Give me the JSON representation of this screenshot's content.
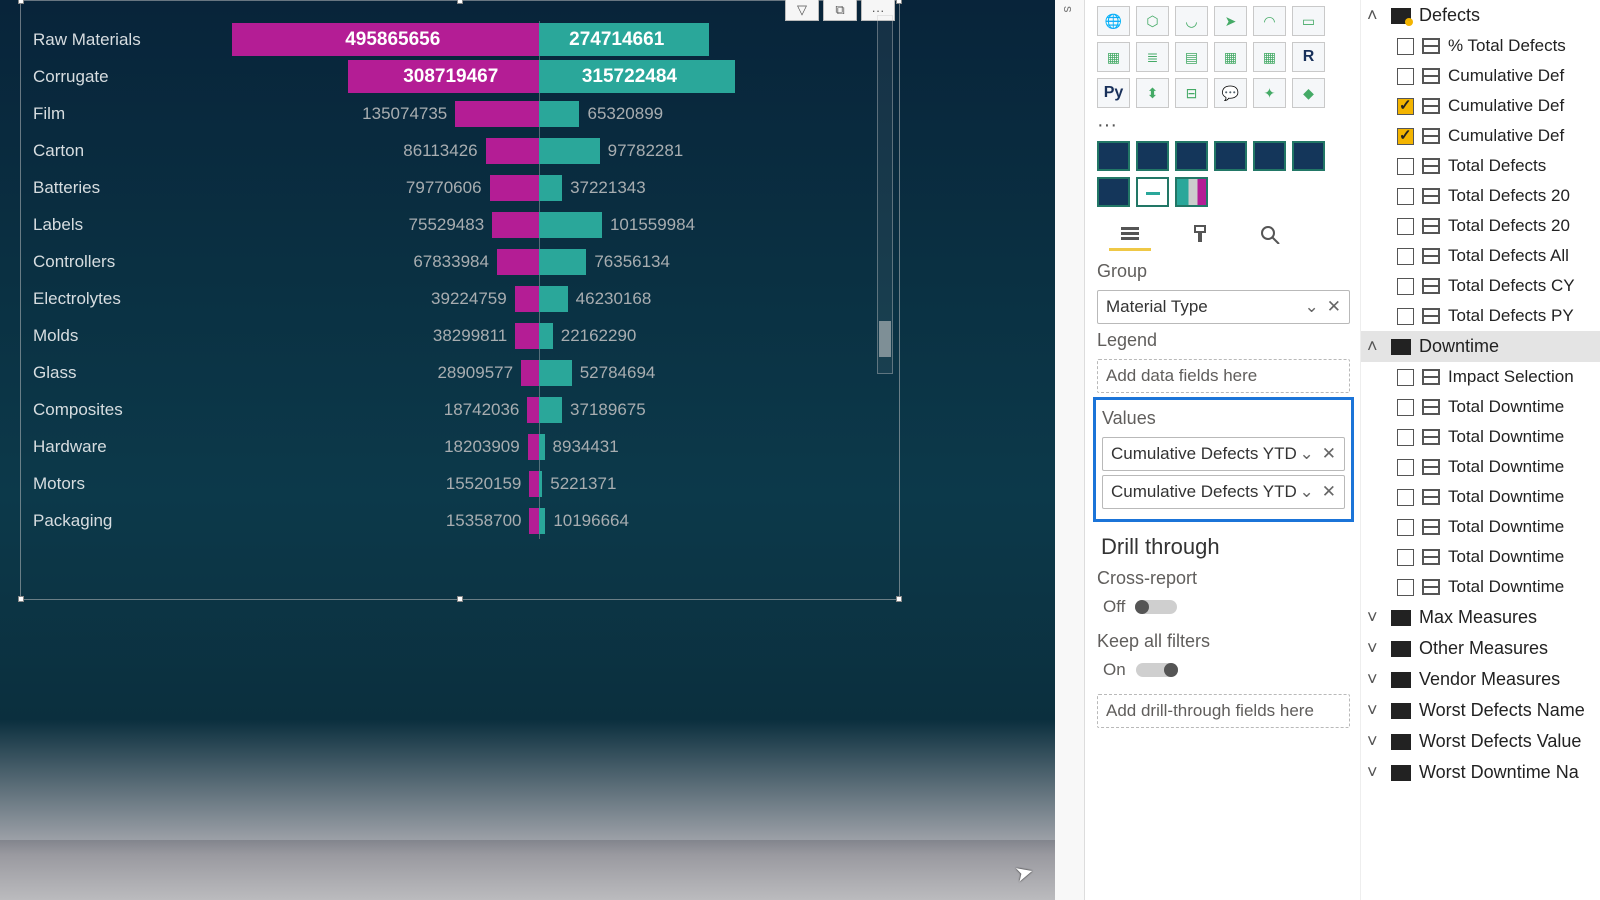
{
  "chart_data": {
    "type": "bar",
    "orientation": "diverging-horizontal",
    "categories": [
      "Raw Materials",
      "Corrugate",
      "Film",
      "Carton",
      "Batteries",
      "Labels",
      "Controllers",
      "Electrolytes",
      "Molds",
      "Glass",
      "Composites",
      "Hardware",
      "Motors",
      "Packaging"
    ],
    "series": [
      {
        "name": "Cumulative Defects YTD (left)",
        "color": "#b41d95",
        "values": [
          495865656,
          308719467,
          135074735,
          86113426,
          79770606,
          75529483,
          67833984,
          39224759,
          38299811,
          28909577,
          18742036,
          18203909,
          15520159,
          15358700
        ]
      },
      {
        "name": "Cumulative Defects YTD (right)",
        "color": "#2aa79a",
        "values": [
          274714661,
          315722484,
          65320899,
          97782281,
          37221343,
          101559984,
          76356134,
          46230168,
          22162290,
          52784694,
          37189675,
          8934431,
          5221371,
          10196664
        ]
      }
    ],
    "xlabel": "",
    "ylabel": "",
    "x_range": [
      -500000000,
      500000000
    ]
  },
  "vis_header": {
    "filter": "▽",
    "focus": "⧉",
    "more": "···"
  },
  "viz_pane": {
    "gallery_row1": [
      "globe",
      "shield",
      "arc",
      "arrow",
      "gauge",
      "card"
    ],
    "gallery_row2": [
      "table",
      "rows",
      "grid",
      "matrix",
      "matrix2",
      "R"
    ],
    "gallery_row3": [
      "Py",
      "kpi",
      "tree",
      "chat",
      "ai",
      "shape"
    ],
    "custom_row1": [
      "c1",
      "c2",
      "c3",
      "c4",
      "c5",
      "c6"
    ],
    "custom_row2": [
      "c7",
      "c8",
      "c9"
    ],
    "tabs": {
      "fields": "fields",
      "format": "format",
      "analytics": "analytics"
    },
    "group_label": "Group",
    "group_field": "Material Type",
    "legend_label": "Legend",
    "legend_placeholder": "Add data fields here",
    "values_label": "Values",
    "values_fields": [
      "Cumulative Defects YTD",
      "Cumulative Defects YTD"
    ],
    "drill_title": "Drill through",
    "cross_report_label": "Cross-report",
    "cross_report_state": "Off",
    "keep_filters_label": "Keep all filters",
    "keep_filters_state": "On",
    "drill_placeholder": "Add drill-through fields here"
  },
  "fields_pane": {
    "tables": [
      {
        "name": "Defects",
        "expanded": true,
        "alert": true,
        "fields": [
          {
            "label": "% Total Defects",
            "checked": false
          },
          {
            "label": "Cumulative Def",
            "checked": false
          },
          {
            "label": "Cumulative Def",
            "checked": true
          },
          {
            "label": "Cumulative Def",
            "checked": true
          },
          {
            "label": "Total Defects",
            "checked": false
          },
          {
            "label": "Total Defects 20",
            "checked": false
          },
          {
            "label": "Total Defects 20",
            "checked": false
          },
          {
            "label": "Total Defects All",
            "checked": false
          },
          {
            "label": "Total Defects CY",
            "checked": false
          },
          {
            "label": "Total Defects PY",
            "checked": false
          }
        ]
      },
      {
        "name": "Downtime",
        "expanded": true,
        "alert": false,
        "selected": true,
        "fields": [
          {
            "label": "Impact Selection",
            "checked": false
          },
          {
            "label": "Total Downtime",
            "checked": false
          },
          {
            "label": "Total Downtime",
            "checked": false
          },
          {
            "label": "Total Downtime",
            "checked": false
          },
          {
            "label": "Total Downtime",
            "checked": false
          },
          {
            "label": "Total Downtime",
            "checked": false
          },
          {
            "label": "Total Downtime",
            "checked": false
          },
          {
            "label": "Total Downtime",
            "checked": false
          }
        ]
      },
      {
        "name": "Max Measures",
        "expanded": false
      },
      {
        "name": "Other Measures",
        "expanded": false
      },
      {
        "name": "Vendor Measures",
        "expanded": false
      },
      {
        "name": "Worst Defects Name",
        "expanded": false
      },
      {
        "name": "Worst Defects Value",
        "expanded": false
      },
      {
        "name": "Worst Downtime Na",
        "expanded": false
      }
    ]
  }
}
